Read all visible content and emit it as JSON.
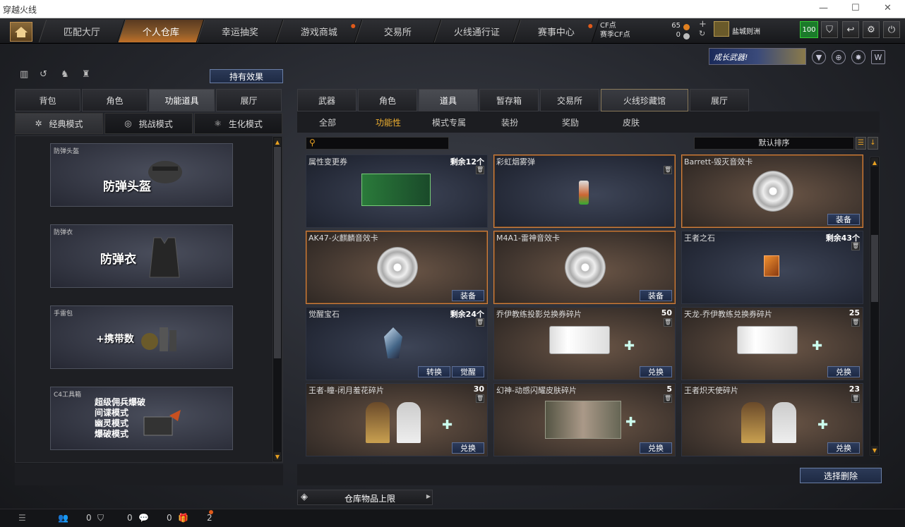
{
  "window": {
    "title": "穿越火线",
    "min": "—",
    "max": "☐",
    "close": "✕"
  },
  "nav": {
    "tabs": [
      {
        "label": "匹配大厅",
        "active": false,
        "dot": false
      },
      {
        "label": "个人仓库",
        "active": true,
        "dot": false
      },
      {
        "label": "幸运抽奖",
        "active": false,
        "dot": false
      },
      {
        "label": "游戏商城",
        "active": false,
        "dot": true
      },
      {
        "label": "交易所",
        "active": false,
        "dot": false
      },
      {
        "label": "火线通行证",
        "active": false,
        "dot": false
      },
      {
        "label": "赛事中心",
        "active": false,
        "dot": true
      }
    ],
    "cf_label": "CF点",
    "cf_value": "65",
    "cf_event_label": "赛季CF点",
    "cf_event_value": "0",
    "plus": "+",
    "refresh": "↻",
    "rank_name": "盐城则洲",
    "level": "100"
  },
  "banner": {
    "text": "成长武器!"
  },
  "left": {
    "holding_effect": "持有效果",
    "tabs": [
      {
        "label": "背包",
        "active": false
      },
      {
        "label": "角色",
        "active": false
      },
      {
        "label": "功能道具",
        "active": true
      },
      {
        "label": "展厅",
        "active": false
      }
    ],
    "modes": [
      {
        "label": "经典模式",
        "active": true
      },
      {
        "label": "挑战模式",
        "active": false
      },
      {
        "label": "生化模式",
        "active": false
      }
    ],
    "cards": [
      {
        "label": "防弹头盔",
        "big": "防弹头盔"
      },
      {
        "label": "防弹衣",
        "big": "防弹衣"
      },
      {
        "label": "手雷包",
        "big": "+携带数"
      },
      {
        "label": "C4工具箱",
        "lines": [
          "超级佣兵爆破",
          "间谍模式",
          "幽灵模式",
          "爆破模式"
        ]
      }
    ]
  },
  "right": {
    "tabs": [
      {
        "label": "武器",
        "active": false
      },
      {
        "label": "角色",
        "active": false
      },
      {
        "label": "道具",
        "active": true
      },
      {
        "label": "暂存箱",
        "active": false
      },
      {
        "label": "交易所",
        "active": false
      },
      {
        "label": "火线珍藏馆",
        "active": false
      },
      {
        "label": "展厅",
        "active": false
      }
    ],
    "filters": [
      {
        "label": "全部",
        "active": false
      },
      {
        "label": "功能性",
        "active": true
      },
      {
        "label": "模式专属",
        "active": false
      },
      {
        "label": "装扮",
        "active": false
      },
      {
        "label": "奖励",
        "active": false
      },
      {
        "label": "皮肤",
        "active": false
      }
    ],
    "sort_label": "默认排序",
    "items": [
      {
        "name": "属性变更券",
        "count": "剩余12个",
        "trash": true,
        "actions": [],
        "style": "cool",
        "pic": "ticket-card"
      },
      {
        "name": "彩虹烟雾弹",
        "count": "",
        "trash": true,
        "actions": [],
        "style": "cool",
        "sel": true,
        "pic": "grenade"
      },
      {
        "name": "Barrett-毁灭音效卡",
        "count": "",
        "trash": false,
        "actions": [
          "装备"
        ],
        "style": "warm",
        "sel": true,
        "pic": "disc"
      },
      {
        "name": "AK47-火麒麟音效卡",
        "count": "",
        "trash": false,
        "actions": [
          "装备"
        ],
        "style": "warm",
        "sel": true,
        "pic": "disc"
      },
      {
        "name": "M4A1-雷神音效卡",
        "count": "",
        "trash": false,
        "actions": [
          "装备"
        ],
        "style": "warm",
        "sel": true,
        "pic": "disc"
      },
      {
        "name": "王者之石",
        "count": "剩余43个",
        "trash": true,
        "actions": [],
        "style": "cool",
        "pic": "stone"
      },
      {
        "name": "觉醒宝石",
        "count": "剩余24个",
        "trash": true,
        "actions": [
          "转换",
          "觉醒"
        ],
        "style": "cool",
        "pic": "gem"
      },
      {
        "name": "乔伊教练投影兑换券碎片",
        "count": "50",
        "trash": true,
        "actions": [
          "兑换"
        ],
        "style": "warm",
        "pic": "ticket"
      },
      {
        "name": "天龙-乔伊教练兑换券碎片",
        "count": "25",
        "trash": true,
        "actions": [
          "兑换"
        ],
        "style": "warm",
        "pic": "ticket"
      },
      {
        "name": "王者-瞳-闭月羞花碎片",
        "count": "30",
        "trash": true,
        "actions": [
          "兑换"
        ],
        "style": "warm",
        "pic": "chars"
      },
      {
        "name": "幻神-动感闪耀皮肤碎片",
        "count": "5",
        "trash": true,
        "actions": [
          "兑换"
        ],
        "style": "warm",
        "pic": "gun"
      },
      {
        "name": "王者炽天使碎片",
        "count": "23",
        "trash": true,
        "actions": [
          "兑换"
        ],
        "style": "warm",
        "pic": "chars"
      }
    ],
    "select_delete": "选择删除",
    "storage_limit": "仓库物品上限"
  },
  "status": {
    "v1": "0",
    "v2": "0",
    "v3": "0",
    "v4": "2"
  }
}
